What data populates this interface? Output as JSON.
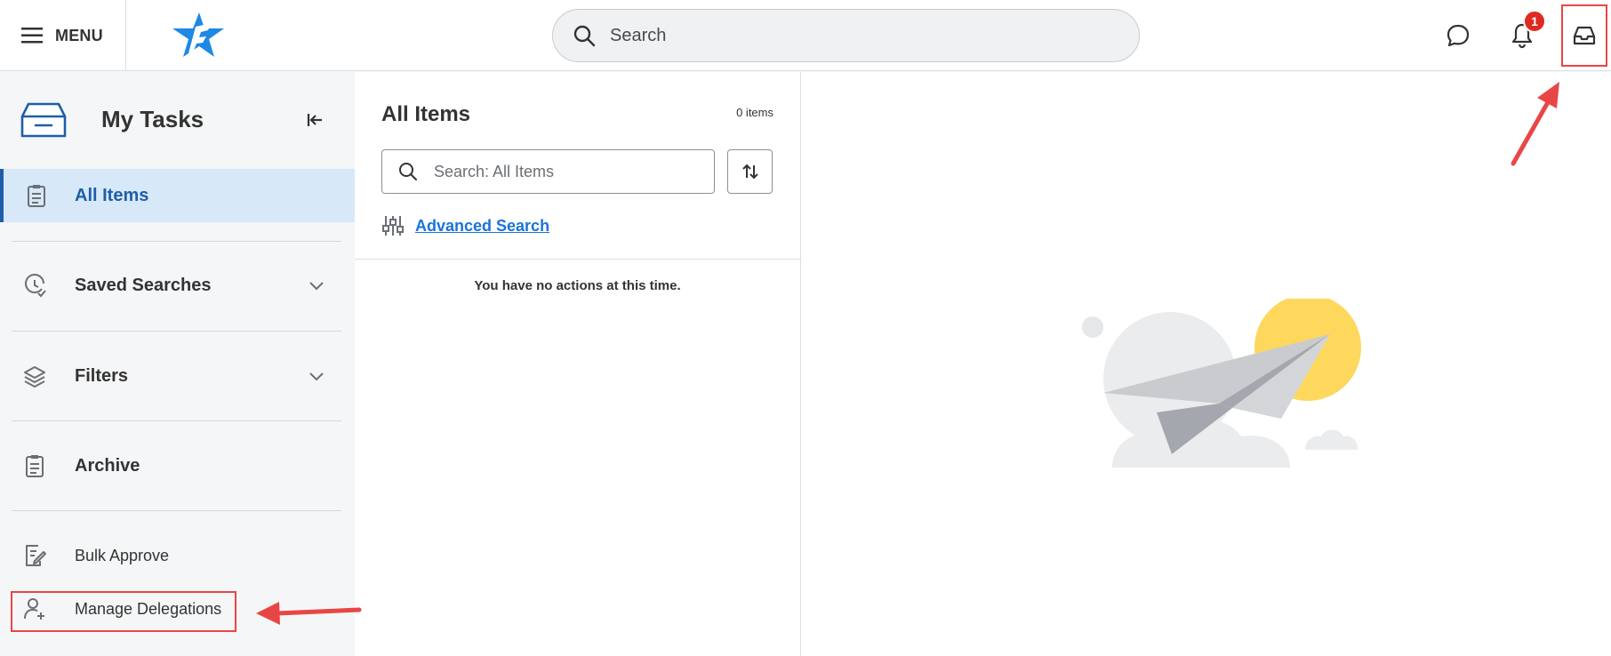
{
  "topbar": {
    "menu_label": "MENU",
    "search_placeholder": "Search",
    "notification_count": "1",
    "icons": [
      "menu-icon",
      "logo-star",
      "search-icon",
      "chat-icon",
      "bell-icon",
      "inbox-icon"
    ]
  },
  "sidebar": {
    "title": "My Tasks",
    "items": [
      {
        "label": "All Items",
        "icon": "clipboard-icon",
        "active": true
      },
      {
        "label": "Saved Searches",
        "icon": "clock-check-icon",
        "expandable": true
      },
      {
        "label": "Filters",
        "icon": "layers-icon",
        "expandable": true
      },
      {
        "label": "Archive",
        "icon": "clipboard-icon"
      },
      {
        "label": "Bulk Approve",
        "icon": "document-edit-icon"
      },
      {
        "label": "Manage Delegations",
        "icon": "user-add-icon"
      }
    ]
  },
  "list_panel": {
    "title": "All Items",
    "count": "0 items",
    "search_placeholder": "Search: All Items",
    "advanced_search": "Advanced Search",
    "empty_message": "You have no actions at this time."
  },
  "colors": {
    "accent": "#1e5ea8",
    "active_bg": "#d7e8f8",
    "link": "#1a73d9",
    "badge": "#de2a21",
    "annotation": "#e84646"
  }
}
